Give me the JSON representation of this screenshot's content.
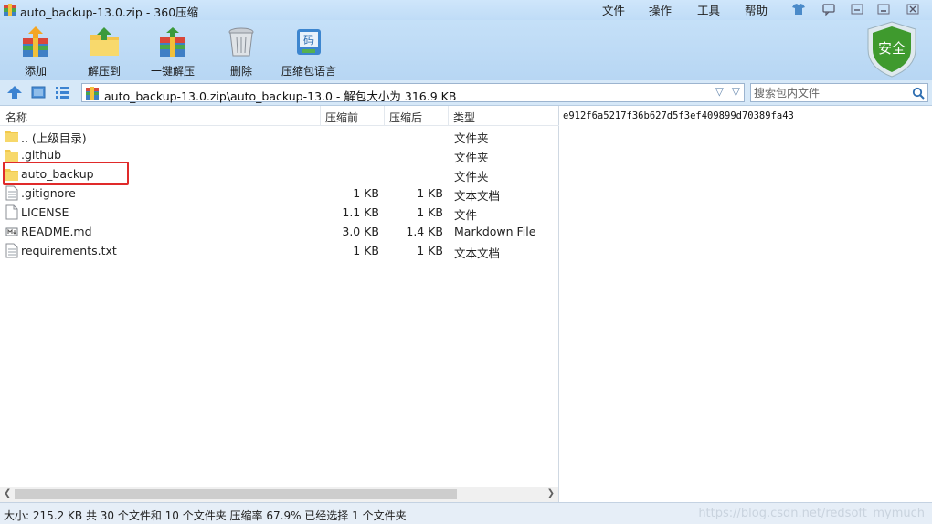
{
  "window": {
    "title": "auto_backup-13.0.zip - 360压缩",
    "menu": [
      "文件",
      "操作",
      "工具",
      "帮助"
    ]
  },
  "toolbar": {
    "items": [
      {
        "label": "添加",
        "icon": "add-books-icon"
      },
      {
        "label": "解压到",
        "icon": "extract-to-folder-icon"
      },
      {
        "label": "一键解压",
        "icon": "one-click-extract-icon"
      },
      {
        "label": "删除",
        "icon": "trash-icon"
      },
      {
        "label": "压缩包语言",
        "icon": "archive-language-icon"
      }
    ],
    "badge": "安全"
  },
  "address": {
    "path": "auto_backup-13.0.zip\\auto_backup-13.0 - 解包大小为 316.9 KB"
  },
  "search": {
    "placeholder": "搜索包内文件"
  },
  "columns": {
    "name": "名称",
    "compressed": "压缩前",
    "packed": "压缩后",
    "type": "类型"
  },
  "files": [
    {
      "name": ".. (上级目录)",
      "size_before": "",
      "size_after": "",
      "type": "文件夹",
      "icon": "folder"
    },
    {
      "name": ".github",
      "size_before": "",
      "size_after": "",
      "type": "文件夹",
      "icon": "folder"
    },
    {
      "name": "auto_backup",
      "size_before": "",
      "size_after": "",
      "type": "文件夹",
      "icon": "folder"
    },
    {
      "name": ".gitignore",
      "size_before": "1 KB",
      "size_after": "1 KB",
      "type": "文本文档",
      "icon": "text"
    },
    {
      "name": "LICENSE",
      "size_before": "1.1 KB",
      "size_after": "1 KB",
      "type": "文件",
      "icon": "file"
    },
    {
      "name": "README.md",
      "size_before": "3.0 KB",
      "size_after": "1.4 KB",
      "type": "Markdown File",
      "icon": "markdown"
    },
    {
      "name": "requirements.txt",
      "size_before": "1 KB",
      "size_after": "1 KB",
      "type": "文本文档",
      "icon": "text"
    }
  ],
  "comment": {
    "text": "e912f6a5217f36b627d5f3ef409899d70389fa43"
  },
  "status": {
    "text": "大小: 215.2 KB 共 30 个文件和 10 个文件夹 压缩率 67.9% 已经选择 1 个文件夹",
    "watermark": "https://blog.csdn.net/redsoft_mymuch"
  },
  "colors": {
    "title_bg": "#cfe6fb",
    "selection_outline": "#e02a2a",
    "shield": "#3f9a2e"
  }
}
